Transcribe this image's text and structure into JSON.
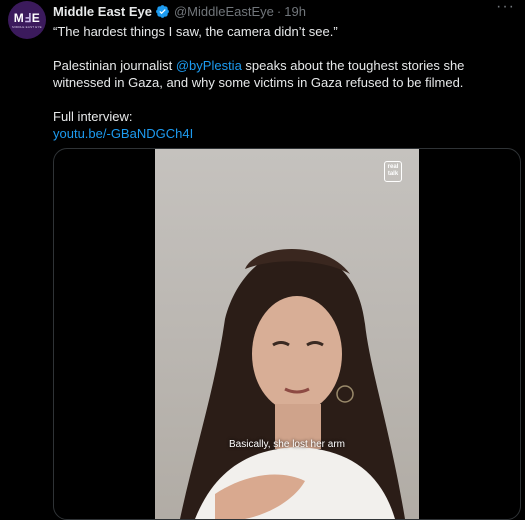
{
  "account": {
    "avatar_logo": "MEE",
    "avatar_tagline": "MIDDLE EAST EYE",
    "name": "Middle East Eye",
    "handle": "@MiddleEastEye",
    "separator": "·",
    "time": "19h",
    "verified_color": "#1d9bf0"
  },
  "tweet": {
    "quote": "“The hardest things I saw, the camera didn’t see.”",
    "body_prefix": "Palestinian journalist ",
    "mention": "@byPlestia",
    "body_suffix": " speaks about the toughest stories she witnessed in Gaza, and why some victims in Gaza refused to be filmed.",
    "interview_label": "Full interview:",
    "link": "youtu.be/-GBaNDGCh4I"
  },
  "media": {
    "brand_badge_top": "real",
    "brand_badge_bottom": "talk",
    "subtitle": "Basically, she lost her arm"
  },
  "colors": {
    "background": "#000000",
    "text": "#e7e9ea",
    "secondary": "#71767b",
    "accent": "#1d9bf0"
  },
  "icons": {
    "verified": "verified-badge-icon",
    "more": "more-options-icon"
  }
}
